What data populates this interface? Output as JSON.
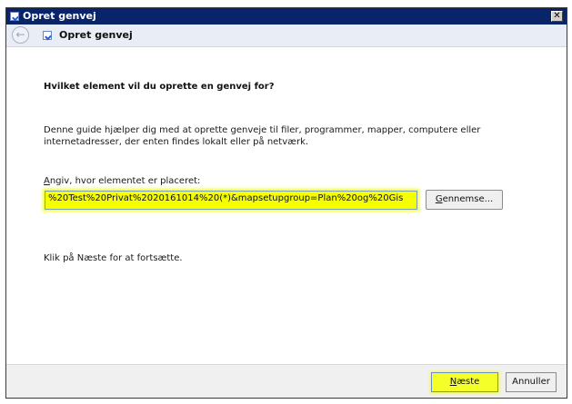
{
  "window": {
    "title": "Opret genvej",
    "close_glyph": "✕"
  },
  "nav": {
    "back_glyph": "←",
    "title": "Opret genvej"
  },
  "main": {
    "heading": "Hvilket element vil du oprette en genvej for?",
    "description": "Denne guide hjælper dig med at oprette genveje til filer, programmer, mapper, computere eller internetadresser, der enten findes lokalt eller på netværk.",
    "location_label_accesskey": "A",
    "location_label_rest": "ngiv, hvor elementet er placeret:",
    "location_value": "%20Test%20Privat%2020161014%20(*)&mapsetupgroup=Plan%20og%20Gis",
    "browse_accesskey": "G",
    "browse_rest": "ennemse...",
    "continue_text": "Klik på Næste for at fortsætte."
  },
  "footer": {
    "next_accesskey": "N",
    "next_rest": "æste",
    "cancel_label": "Annuller"
  },
  "colors": {
    "highlight": "#f5ff00",
    "titlebar": "#0a246a"
  },
  "icons": [
    "shortcut-icon",
    "back-arrow-icon",
    "close-icon"
  ]
}
